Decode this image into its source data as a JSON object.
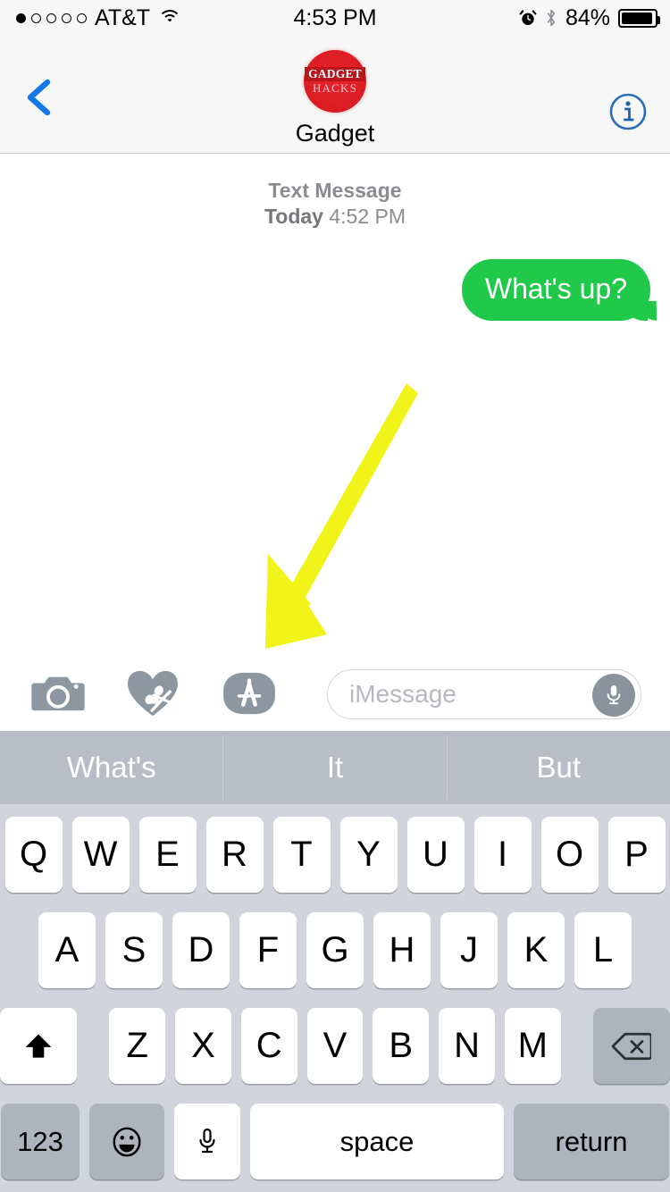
{
  "status_bar": {
    "carrier": "AT&T",
    "signal_dots_total": 5,
    "signal_dots_filled": 1,
    "wifi_icon": "wifi-icon",
    "time": "4:53 PM",
    "alarm_icon": "alarm-clock-icon",
    "bluetooth_icon": "bluetooth-icon",
    "battery_percent": "84%",
    "battery_level": 84
  },
  "nav_bar": {
    "back_icon": "back-chevron-icon",
    "info_icon": "info-circle-icon",
    "contact_name": "Gadget",
    "avatar": {
      "icon": "contact-avatar",
      "line1": "GADGET",
      "line2": "HACKS",
      "background_color": "#dd1d24"
    }
  },
  "conversation": {
    "service_label": "Text Message",
    "date_label": "Today",
    "time_label": "4:52 PM",
    "messages": [
      {
        "text": "What's up?",
        "direction": "outgoing",
        "bubble_color": "#21c94b",
        "text_color": "#ffffff"
      }
    ]
  },
  "annotation": {
    "arrow_color": "#f2f319",
    "points_to": "app-store-button"
  },
  "input_bar": {
    "camera_icon": "camera-icon",
    "digital_touch_icon": "digital-touch-heart-icon",
    "app_store_icon": "app-store-icon",
    "field_placeholder": "iMessage",
    "field_value": "",
    "mic_icon": "microphone-icon"
  },
  "quicktype": {
    "suggestions": [
      "What's",
      "It",
      "But"
    ]
  },
  "keyboard": {
    "row1": [
      "Q",
      "W",
      "E",
      "R",
      "T",
      "Y",
      "U",
      "I",
      "O",
      "P"
    ],
    "row2": [
      "A",
      "S",
      "D",
      "F",
      "G",
      "H",
      "J",
      "K",
      "L"
    ],
    "row3": [
      "Z",
      "X",
      "C",
      "V",
      "B",
      "N",
      "M"
    ],
    "shift_icon": "shift-arrow-icon",
    "delete_icon": "backspace-icon",
    "numbers_label": "123",
    "emoji_icon": "emoji-smiley-icon",
    "dictation_icon": "microphone-icon",
    "space_label": "space",
    "return_label": "return"
  }
}
